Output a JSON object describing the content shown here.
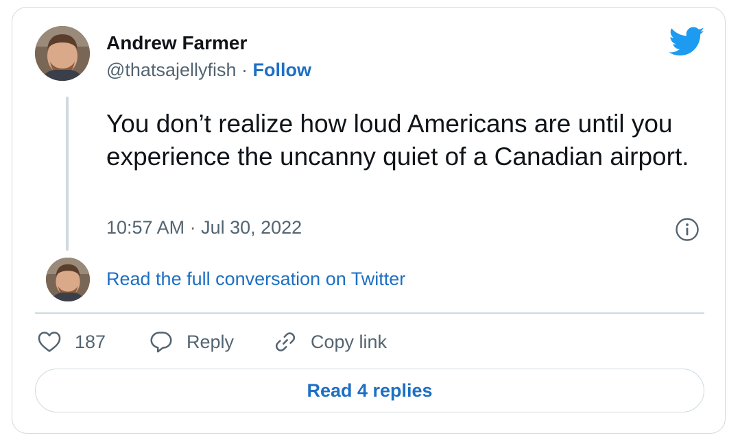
{
  "colors": {
    "link": "#1d6fc4",
    "twitter_blue": "#1d9bf0",
    "text_primary": "#0f1419",
    "text_secondary": "#536471",
    "border": "#cfd9de"
  },
  "author": {
    "name": "Andrew Farmer",
    "handle": "@thatsajellyfish",
    "separator": " · ",
    "follow_label": "Follow",
    "avatar_icon": "user-avatar"
  },
  "tweet": {
    "text": "You don’t realize how loud Americans are until you experience the uncanny quiet of a Canadian airport.",
    "timestamp": "10:57 AM · Jul 30, 2022"
  },
  "conversation": {
    "read_full_label": "Read the full conversation on Twitter"
  },
  "actions": {
    "like_count": "187",
    "reply_label": "Reply",
    "copy_link_label": "Copy link"
  },
  "footer": {
    "read_replies_label": "Read 4 replies"
  },
  "icons": {
    "brand": "twitter-bird-icon",
    "info": "info-icon",
    "like": "heart-icon",
    "reply": "speech-bubble-icon",
    "copy": "link-icon"
  }
}
